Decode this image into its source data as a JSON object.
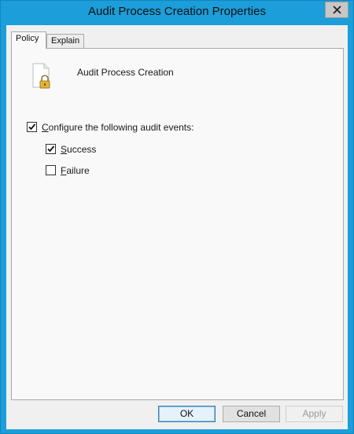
{
  "window": {
    "title": "Audit Process Creation Properties"
  },
  "tabs": [
    {
      "label": "Policy",
      "active": true
    },
    {
      "label": "Explain",
      "active": false
    }
  ],
  "policy": {
    "name": "Audit Process Creation",
    "icon": "policy-document-lock-icon"
  },
  "options": {
    "configure": {
      "label": "Configure the following audit events:",
      "underline": "C",
      "rest": "onfigure the following audit events:",
      "checked": true
    },
    "success": {
      "label": "Success",
      "underline": "S",
      "rest": "uccess",
      "checked": true
    },
    "failure": {
      "label": "Failure",
      "underline": "F",
      "rest": "ailure",
      "checked": false
    }
  },
  "buttons": {
    "ok": "OK",
    "cancel": "Cancel",
    "apply": "Apply"
  },
  "colors": {
    "titlebar": "#1b9ed9",
    "dialog_bg": "#f0f0f0",
    "panel_bg": "#f9f9f9"
  }
}
